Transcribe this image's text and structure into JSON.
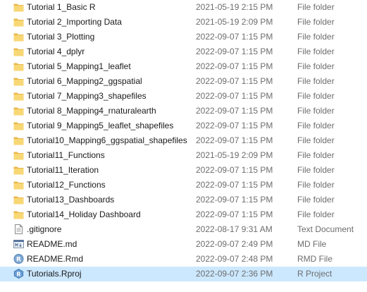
{
  "files": [
    {
      "name": "Tutorial 1_Basic R",
      "date": "2021-05-19 2:15 PM",
      "type": "File folder",
      "icon": "folder-icon"
    },
    {
      "name": "Tutorial 2_Importing Data",
      "date": "2021-05-19 2:09 PM",
      "type": "File folder",
      "icon": "folder-icon"
    },
    {
      "name": "Tutorial 3_Plotting",
      "date": "2022-09-07 1:15 PM",
      "type": "File folder",
      "icon": "folder-icon"
    },
    {
      "name": "Tutorial 4_dplyr",
      "date": "2022-09-07 1:15 PM",
      "type": "File folder",
      "icon": "folder-icon"
    },
    {
      "name": "Tutorial 5_Mapping1_leaflet",
      "date": "2022-09-07 1:15 PM",
      "type": "File folder",
      "icon": "folder-icon"
    },
    {
      "name": "Tutorial 6_Mapping2_ggspatial",
      "date": "2022-09-07 1:15 PM",
      "type": "File folder",
      "icon": "folder-icon"
    },
    {
      "name": "Tutorial 7_Mapping3_shapefiles",
      "date": "2022-09-07 1:15 PM",
      "type": "File folder",
      "icon": "folder-icon"
    },
    {
      "name": "Tutorial 8_Mapping4_rnaturalearth",
      "date": "2022-09-07 1:15 PM",
      "type": "File folder",
      "icon": "folder-icon"
    },
    {
      "name": "Tutorial 9_Mapping5_leaflet_shapefiles",
      "date": "2022-09-07 1:15 PM",
      "type": "File folder",
      "icon": "folder-icon"
    },
    {
      "name": "Tutorial10_Mapping6_ggspatial_shapefiles",
      "date": "2022-09-07 1:15 PM",
      "type": "File folder",
      "icon": "folder-icon"
    },
    {
      "name": "Tutorial11_Functions",
      "date": "2021-05-19 2:09 PM",
      "type": "File folder",
      "icon": "folder-icon"
    },
    {
      "name": "Tutorial11_Iteration",
      "date": "2022-09-07 1:15 PM",
      "type": "File folder",
      "icon": "folder-icon"
    },
    {
      "name": "Tutorial12_Functions",
      "date": "2022-09-07 1:15 PM",
      "type": "File folder",
      "icon": "folder-icon"
    },
    {
      "name": "Tutorial13_Dashboards",
      "date": "2022-09-07 1:15 PM",
      "type": "File folder",
      "icon": "folder-icon"
    },
    {
      "name": "Tutorial14_Holiday Dashboard",
      "date": "2022-09-07 1:15 PM",
      "type": "File folder",
      "icon": "folder-icon"
    },
    {
      "name": ".gitignore",
      "date": "2022-08-17 9:31 AM",
      "type": "Text Document",
      "icon": "text-document-icon"
    },
    {
      "name": "README.md",
      "date": "2022-09-07 2:49 PM",
      "type": "MD File",
      "icon": "markdown-file-icon"
    },
    {
      "name": "README.Rmd",
      "date": "2022-09-07 2:48 PM",
      "type": "RMD File",
      "icon": "rmd-file-icon"
    },
    {
      "name": "Tutorials.Rproj",
      "date": "2022-09-07 2:36 PM",
      "type": "R Project",
      "icon": "rproj-file-icon",
      "selected": true
    }
  ],
  "colors": {
    "folder": "#f8d775",
    "folder_dark": "#e8b84a",
    "selection": "#cce8ff",
    "secondary_text": "#6d6d6d"
  }
}
